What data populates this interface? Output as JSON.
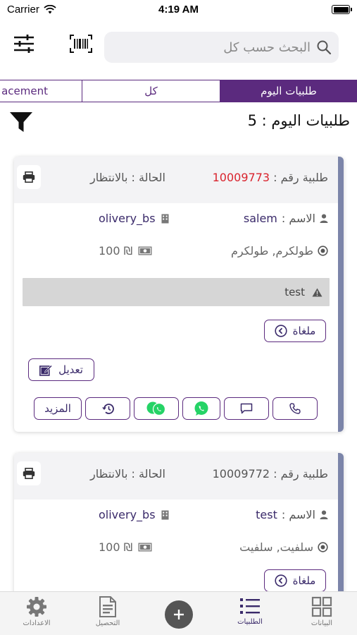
{
  "status_bar": {
    "carrier": "Carrier",
    "time": "4:19 AM"
  },
  "search": {
    "placeholder": "البحث حسب كل"
  },
  "tabs": [
    {
      "label": "acement"
    },
    {
      "label": "كل"
    },
    {
      "label": "طلبيات اليوم"
    }
  ],
  "count_title": "طلبيات اليوم : 5",
  "orders": [
    {
      "order_label": "طلبية رقم :",
      "order_number": "10009773",
      "status": "الحالة : بالانتظار",
      "name_label": "الاسم :",
      "name": "salem",
      "store": "olivery_bs",
      "address": "طولكرم, طولكرم",
      "amount": "100 ₪",
      "note": "test",
      "cancel_label": "ملغاة",
      "edit_label": "تعديل",
      "more_label": "المزيد"
    },
    {
      "order_label": "طلبية رقم :",
      "order_number": "10009772",
      "status": "الحالة : بالانتظار",
      "name_label": "الاسم :",
      "name": "test",
      "store": "olivery_bs",
      "address": "سلفيت, سلفيت",
      "amount": "100 ₪",
      "cancel_label": "ملغاة"
    }
  ],
  "nav": {
    "settings": "الاعدادات",
    "collection": "التحصيل",
    "orders": "الطلبيات",
    "data": "البيانات"
  },
  "colors": {
    "accent": "#5b2a7e",
    "rail": "#7c85a9",
    "order_red": "#d9232d",
    "whatsapp": "#25d366"
  },
  "icons": [
    "sliders-icon",
    "barcode-icon",
    "search-icon",
    "funnel-icon",
    "printer-icon",
    "person-icon",
    "building-icon",
    "location-icon",
    "cash-icon",
    "warning-icon",
    "chevron-left-circle-icon",
    "edit-icon",
    "history-icon",
    "whatsapp-business-icon",
    "whatsapp-icon",
    "message-icon",
    "phone-icon",
    "gear-icon",
    "document-icon",
    "plus-icon",
    "list-icon",
    "grid-icon"
  ]
}
